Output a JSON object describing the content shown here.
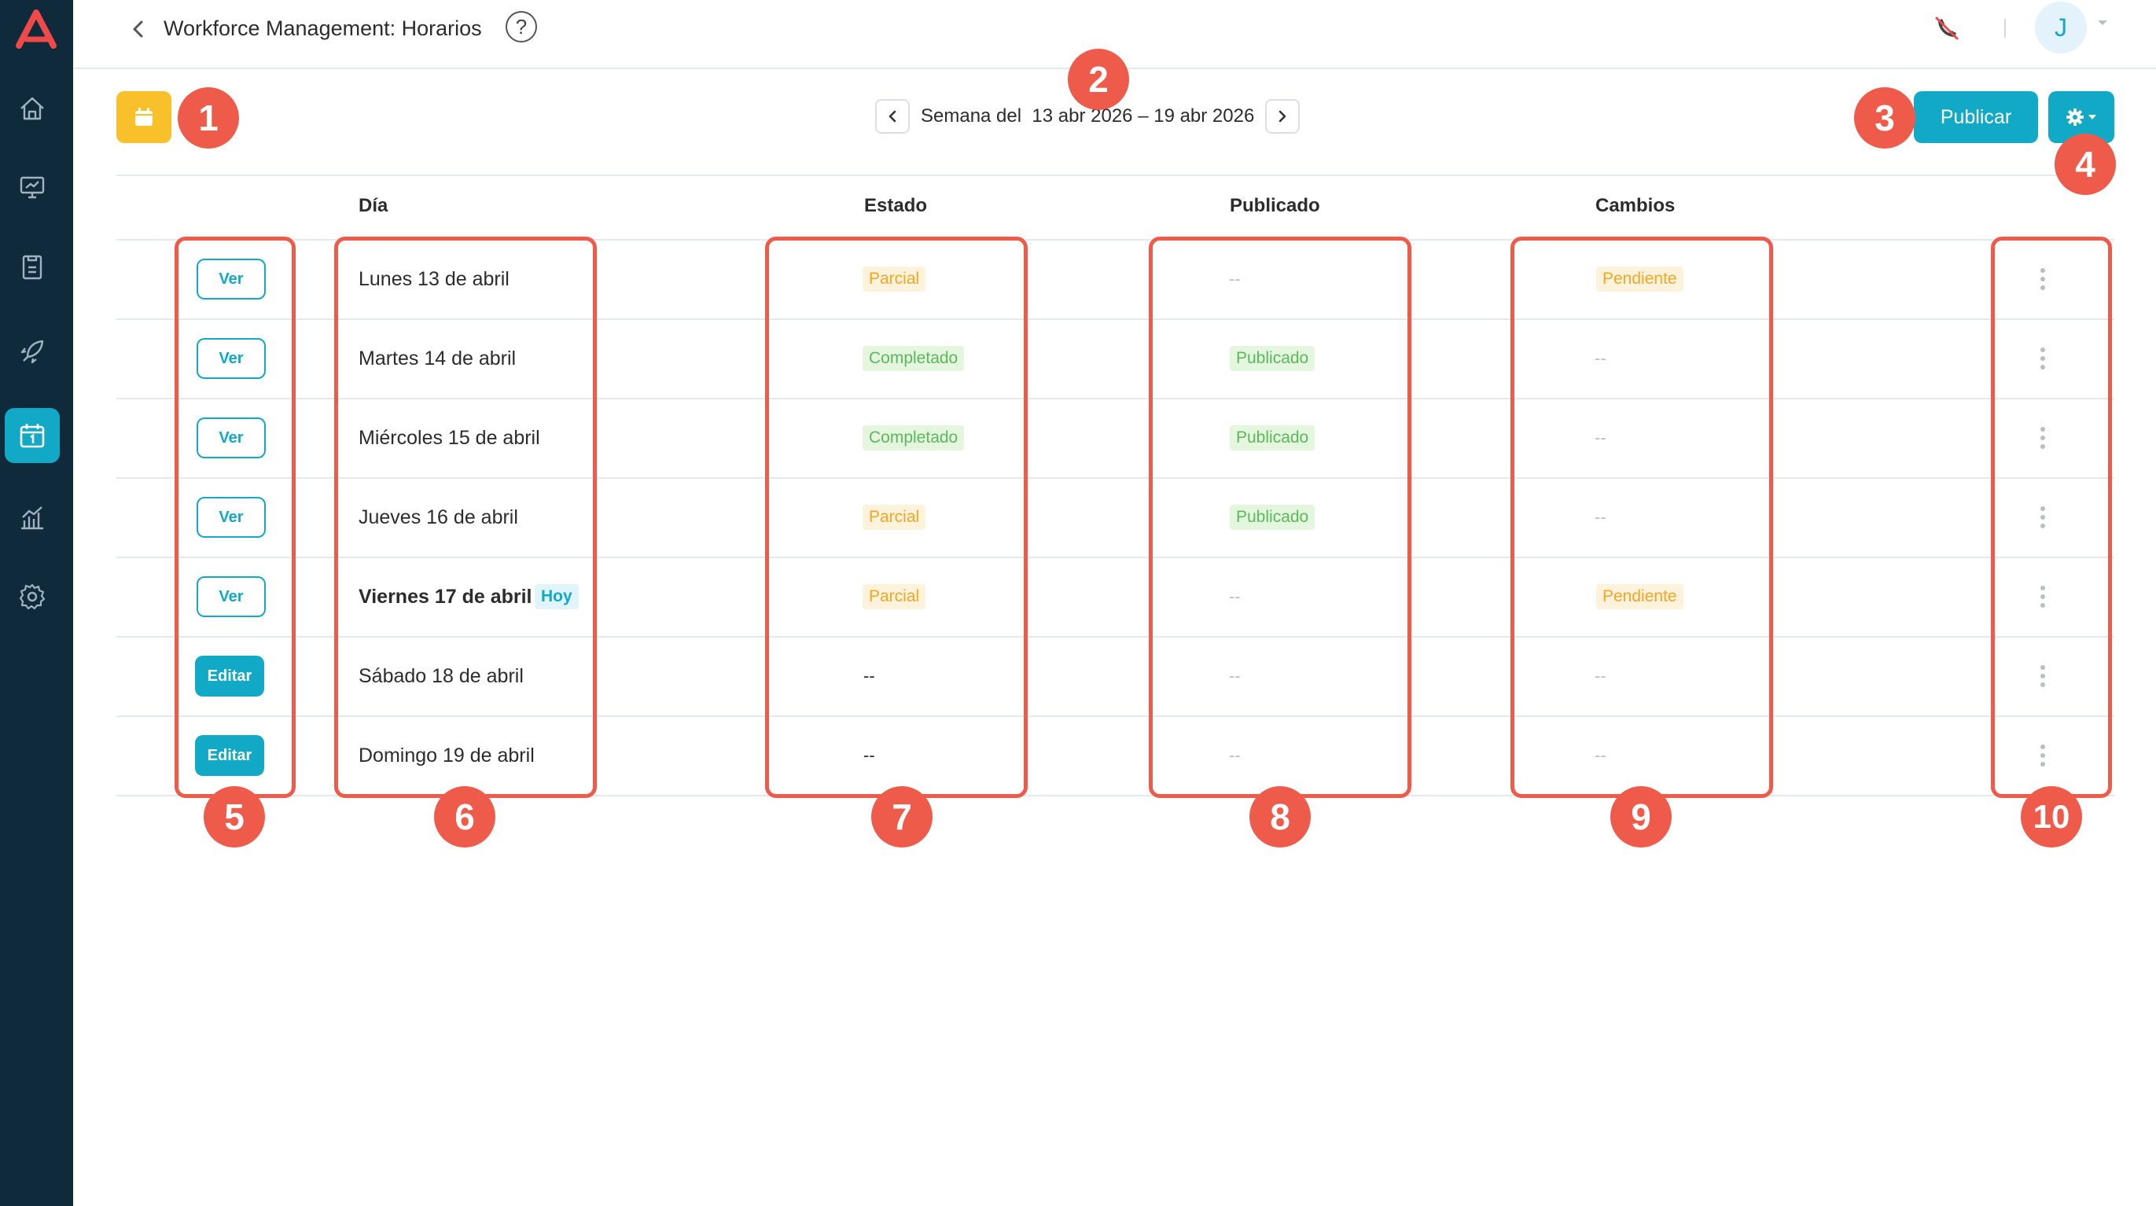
{
  "header": {
    "title": "Workforce Management: Horarios",
    "help": "?",
    "avatar_initial": "J"
  },
  "toolbar": {
    "week_label": "Semana del  13 abr 2026 – 19 abr 2026",
    "publish_label": "Publicar"
  },
  "table": {
    "columns": {
      "day": "Día",
      "status": "Estado",
      "published": "Publicado",
      "changes": "Cambios"
    },
    "rows": [
      {
        "action": "Ver",
        "day": "Lunes 13 de abril",
        "status": "Parcial",
        "published": "--",
        "changes": "Pendiente"
      },
      {
        "action": "Ver",
        "day": "Martes 14 de abril",
        "status": "Completado",
        "published": "Publicado",
        "changes": "--"
      },
      {
        "action": "Ver",
        "day": "Miércoles 15 de abril",
        "status": "Completado",
        "published": "Publicado",
        "changes": "--"
      },
      {
        "action": "Ver",
        "day": "Jueves 16 de abril",
        "status": "Parcial",
        "published": "Publicado",
        "changes": "--"
      },
      {
        "action": "Ver",
        "day": "Viernes 17 de abril",
        "today_badge": "Hoy",
        "status": "Parcial",
        "published": "--",
        "changes": "Pendiente"
      },
      {
        "action": "Editar",
        "day": "Sábado 18 de abril",
        "status": "--",
        "published": "--",
        "changes": "--"
      },
      {
        "action": "Editar",
        "day": "Domingo 19 de abril",
        "status": "--",
        "published": "--",
        "changes": "--"
      }
    ]
  },
  "annotations": [
    "1",
    "2",
    "3",
    "4",
    "5",
    "6",
    "7",
    "8",
    "9",
    "10"
  ],
  "colors": {
    "sidebar": "#0e2a3b",
    "accent": "#12a9c7",
    "calendar_button": "#f8c12c",
    "annotation": "#ef5b4b",
    "partial": "#f5a623",
    "complete": "#5cb85c"
  },
  "sidebar_icons": [
    "logo-icon",
    "home-icon",
    "monitor-icon",
    "document-icon",
    "rocket-icon",
    "calendar-icon",
    "analytics-icon",
    "settings-icon"
  ]
}
